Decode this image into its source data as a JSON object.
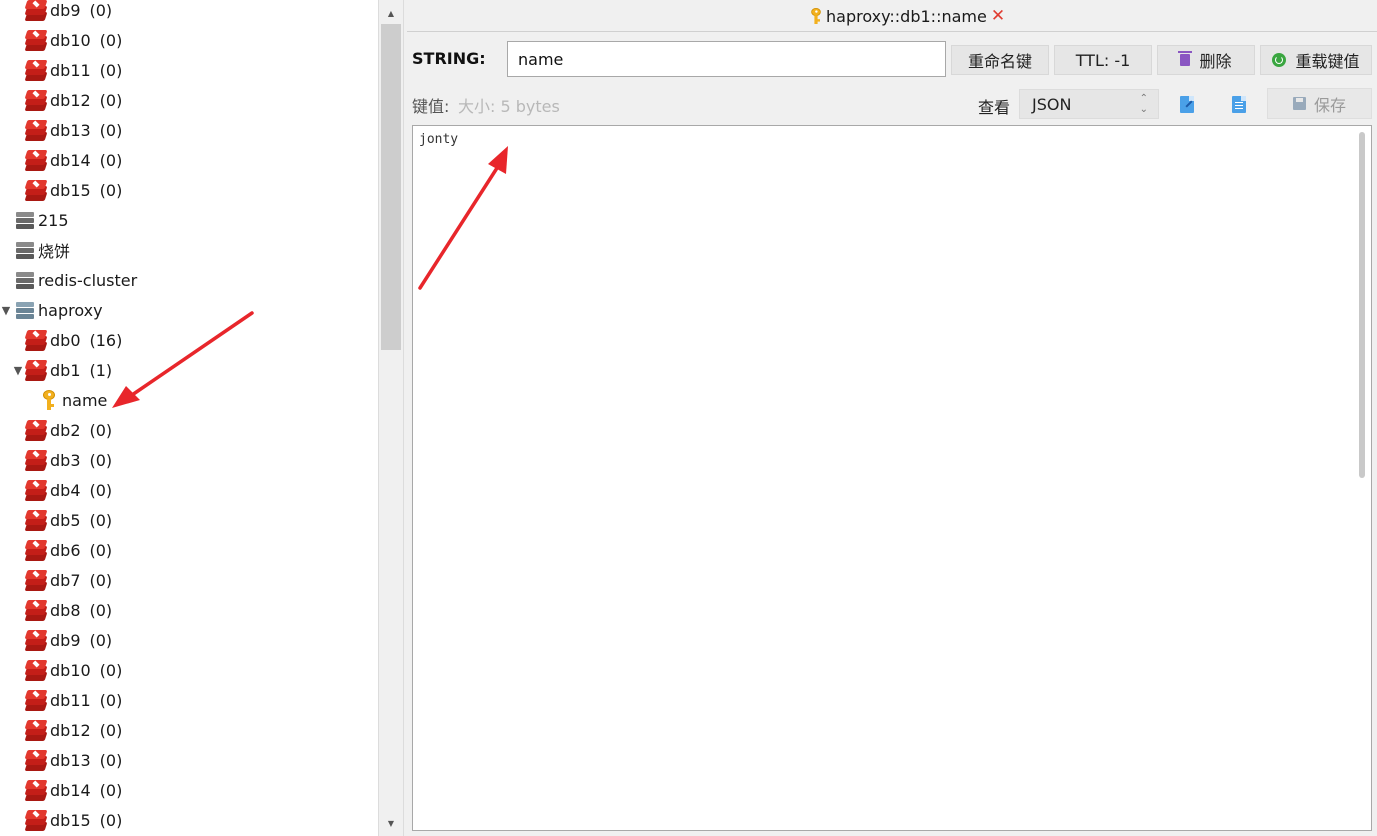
{
  "tree": [
    {
      "type": "db",
      "label": "db9",
      "count": "(0)",
      "indent": 1
    },
    {
      "type": "db",
      "label": "db10",
      "count": "(0)",
      "indent": 1
    },
    {
      "type": "db",
      "label": "db11",
      "count": "(0)",
      "indent": 1
    },
    {
      "type": "db",
      "label": "db12",
      "count": "(0)",
      "indent": 1
    },
    {
      "type": "db",
      "label": "db13",
      "count": "(0)",
      "indent": 1
    },
    {
      "type": "db",
      "label": "db14",
      "count": "(0)",
      "indent": 1
    },
    {
      "type": "db",
      "label": "db15",
      "count": "(0)",
      "indent": 1
    },
    {
      "type": "server",
      "label": "215",
      "count": "",
      "indent": 0
    },
    {
      "type": "server",
      "label": "烧饼",
      "count": "",
      "indent": 0
    },
    {
      "type": "server",
      "label": "redis-cluster",
      "count": "",
      "indent": 0
    },
    {
      "type": "server",
      "label": "haproxy",
      "count": "",
      "indent": 0,
      "expanded": true,
      "active": true
    },
    {
      "type": "db",
      "label": "db0",
      "count": "(16)",
      "indent": 1
    },
    {
      "type": "db",
      "label": "db1",
      "count": "(1)",
      "indent": 1,
      "expanded": true
    },
    {
      "type": "key",
      "label": "name",
      "count": "",
      "indent": 2
    },
    {
      "type": "db",
      "label": "db2",
      "count": "(0)",
      "indent": 1
    },
    {
      "type": "db",
      "label": "db3",
      "count": "(0)",
      "indent": 1
    },
    {
      "type": "db",
      "label": "db4",
      "count": "(0)",
      "indent": 1
    },
    {
      "type": "db",
      "label": "db5",
      "count": "(0)",
      "indent": 1
    },
    {
      "type": "db",
      "label": "db6",
      "count": "(0)",
      "indent": 1
    },
    {
      "type": "db",
      "label": "db7",
      "count": "(0)",
      "indent": 1
    },
    {
      "type": "db",
      "label": "db8",
      "count": "(0)",
      "indent": 1
    },
    {
      "type": "db",
      "label": "db9",
      "count": "(0)",
      "indent": 1
    },
    {
      "type": "db",
      "label": "db10",
      "count": "(0)",
      "indent": 1
    },
    {
      "type": "db",
      "label": "db11",
      "count": "(0)",
      "indent": 1
    },
    {
      "type": "db",
      "label": "db12",
      "count": "(0)",
      "indent": 1
    },
    {
      "type": "db",
      "label": "db13",
      "count": "(0)",
      "indent": 1
    },
    {
      "type": "db",
      "label": "db14",
      "count": "(0)",
      "indent": 1
    },
    {
      "type": "db",
      "label": "db15",
      "count": "(0)",
      "indent": 1
    }
  ],
  "tab": {
    "title": "haproxy::db1::name"
  },
  "key_editor": {
    "type_label": "STRING:",
    "key_name": "name",
    "rename_label": "重命名键",
    "ttl_label": "TTL:  -1",
    "delete_label": "删除",
    "reload_label": "重载键值"
  },
  "value_bar": {
    "value_label": "键值:",
    "size_label": "大小:  5 bytes",
    "view_label": "查看",
    "format": "JSON",
    "save_label": "保存"
  },
  "value": {
    "text": "jonty"
  },
  "colors": {
    "annotation_arrow": "#e8262b",
    "redis_red": "#c8241e",
    "key_gold": "#f2b01e"
  }
}
